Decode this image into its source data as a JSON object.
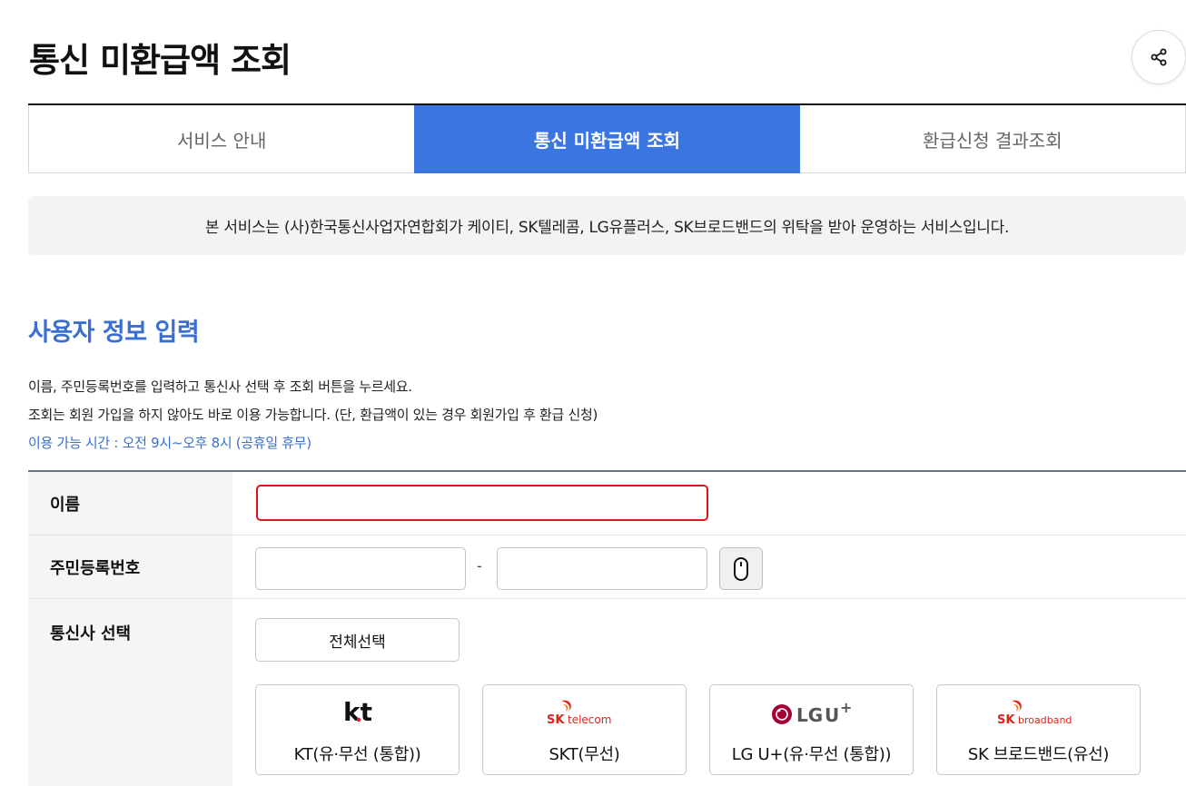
{
  "header": {
    "title": "통신 미환급액 조회",
    "share_icon": "share-icon"
  },
  "tabs": [
    {
      "label": "서비스 안내",
      "active": false
    },
    {
      "label": "통신 미환급액 조회",
      "active": true
    },
    {
      "label": "환급신청 결과조회",
      "active": false
    }
  ],
  "notice": "본 서비스는 (사)한국통신사업자연합회가 케이티, SK텔레콤, LG유플러스, SK브로드밴드의 위탁을 받아 운영하는 서비스입니다.",
  "section": {
    "title": "사용자 정보 입력",
    "desc_line1": "이름, 주민등록번호를 입력하고 통신사 선택 후 조회 버튼을 누르세요.",
    "desc_line2": "조회는 회원 가입을 하지 않아도 바로 이용 가능합니다. (단, 환급액이 있는 경우 회원가입 후 환급 신청)",
    "hours": "이용 가능 시간 : 오전 9시~오후 8시 (공휴일 휴무)"
  },
  "form": {
    "name_label": "이름",
    "name_value": "",
    "rrn_label": "주민등록번호",
    "rrn_front": "",
    "rrn_back": "",
    "rrn_separator": "-",
    "mouse_icon": "mouse-icon",
    "carrier_label": "통신사 선택",
    "select_all": "전체선택",
    "carriers": [
      {
        "name": "KT(유·무선 (통합))",
        "logo_text": "kt",
        "logo_icon": "kt-logo-icon"
      },
      {
        "name": "SKT(무선)",
        "logo_text": "SK telecom",
        "logo_icon": "sk-telecom-logo-icon"
      },
      {
        "name": "LG U+(유·무선 (통합))",
        "logo_text": "LG U+",
        "logo_icon": "lg-uplus-logo-icon"
      },
      {
        "name": "SK 브로드밴드(유선)",
        "logo_text": "SK broadband",
        "logo_icon": "sk-broadband-logo-icon"
      }
    ]
  },
  "colors": {
    "accent": "#3a75e0",
    "section_title": "#3a6fd0",
    "error_border": "#e0141e",
    "kt_red": "#e01e24",
    "sk_red": "#e5231b",
    "sk_orange": "#f47920",
    "lg_magenta": "#a50034"
  }
}
